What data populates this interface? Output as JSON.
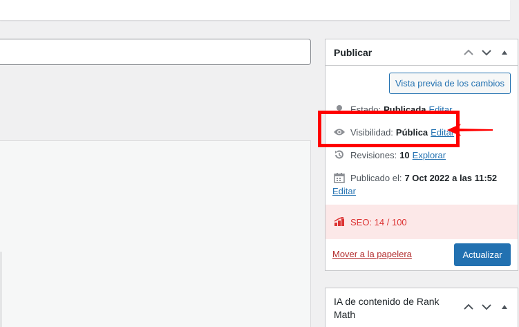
{
  "publish_box": {
    "title": "Publicar",
    "preview_label": "Vista previa de los cambios",
    "status": {
      "label": "Estado:",
      "value": "Publicada",
      "edit": "Editar"
    },
    "visibility": {
      "label": "Visibilidad:",
      "value": "Pública",
      "edit": "Editar"
    },
    "revisions": {
      "label": "Revisiones:",
      "value": "10",
      "link": "Explorar"
    },
    "published": {
      "label": "Publicado el:",
      "value": "7 Oct 2022 a las 11:52",
      "edit": "Editar"
    },
    "seo": {
      "label": "SEO: 14 / 100"
    },
    "trash_label": "Mover a la papelera",
    "update_label": "Actualizar"
  },
  "ai_box": {
    "title": "IA de contenido de Rank Math"
  },
  "colors": {
    "accent": "#2271b1",
    "danger": "#dc3232",
    "annotation": "#ff0000"
  }
}
